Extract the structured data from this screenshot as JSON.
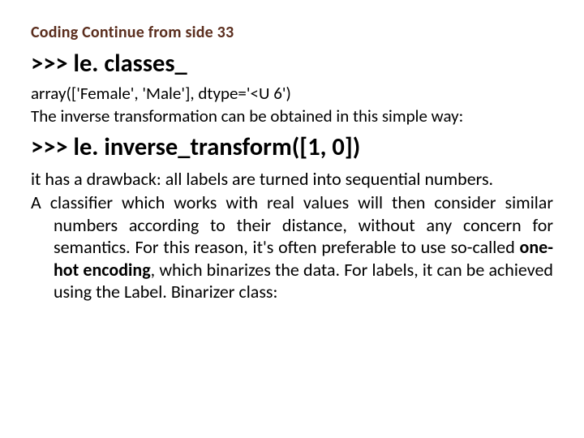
{
  "title": "Coding Continue from side 33",
  "code1": ">>> le. classes_",
  "out1": "array(['Female', 'Male'], dtype='<U 6')",
  "explain1": "The inverse transformation can be obtained in this simple way:",
  "code2": ">>> le. inverse_transform([1, 0])",
  "para1": "it has a drawback: all labels are turned into sequential numbers.",
  "para2_pre": "A classifier which works with real values will then consider similar numbers according to their distance, without any concern for semantics. For this reason, it's often preferable to use so-called ",
  "para2_bold": "one-hot encoding",
  "para2_post": ", which binarizes the data. For labels, it can be achieved using the Label. Binarizer class:"
}
